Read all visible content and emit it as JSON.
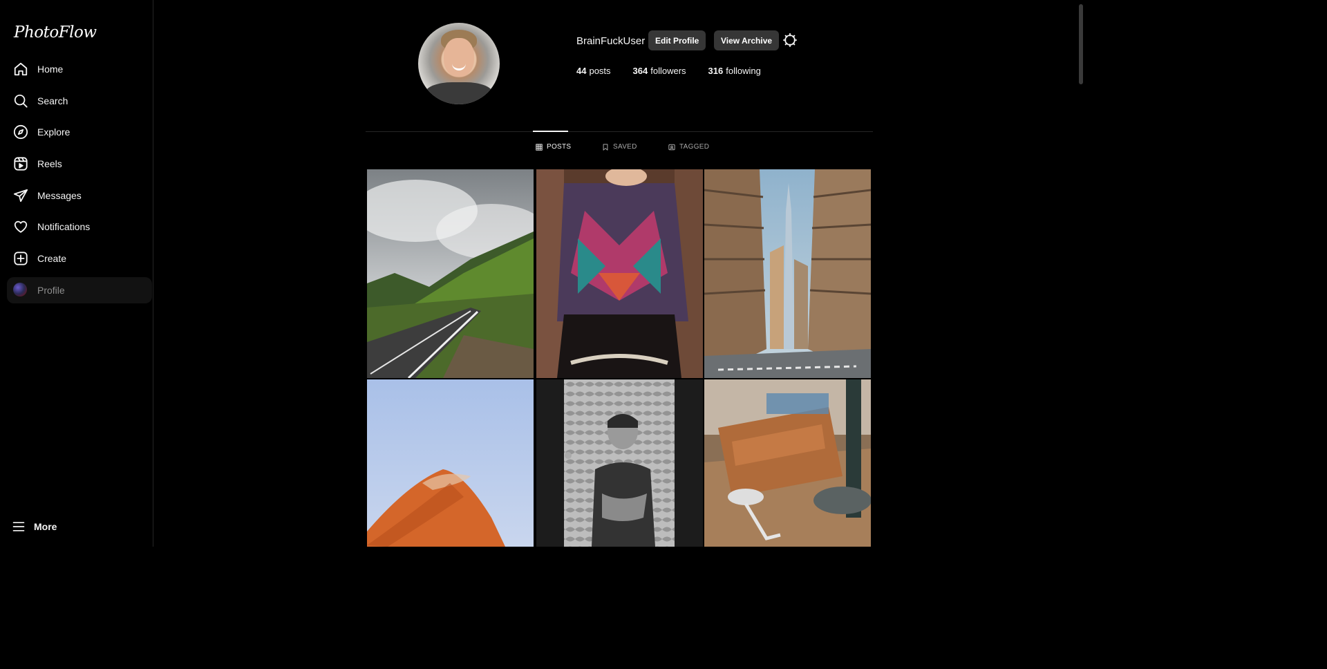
{
  "app": {
    "logo": "PhotoFlow"
  },
  "sidebar": {
    "items": [
      {
        "label": "Home",
        "icon": "home-icon"
      },
      {
        "label": "Search",
        "icon": "search-icon"
      },
      {
        "label": "Explore",
        "icon": "compass-icon"
      },
      {
        "label": "Reels",
        "icon": "reels-icon"
      },
      {
        "label": "Messages",
        "icon": "send-icon"
      },
      {
        "label": "Notifications",
        "icon": "heart-icon"
      },
      {
        "label": "Create",
        "icon": "plus-square-icon"
      },
      {
        "label": "Profile",
        "icon": "avatar",
        "active": true
      }
    ],
    "more_label": "More"
  },
  "profile": {
    "username": "BrainFuckUser",
    "edit_label": "Edit Profile",
    "archive_label": "View Archive",
    "stats": {
      "posts_count": "44",
      "posts_label": "posts",
      "followers_count": "364",
      "followers_label": "followers",
      "following_count": "316",
      "following_label": "following"
    }
  },
  "tabs": [
    {
      "label": "POSTS",
      "icon": "grid-icon",
      "active": true
    },
    {
      "label": "SAVED",
      "icon": "bookmark-icon",
      "active": false
    },
    {
      "label": "TAGGED",
      "icon": "tag-icon",
      "active": false
    }
  ],
  "posts": [
    {
      "subject": "mountain road"
    },
    {
      "subject": "colorful poncho"
    },
    {
      "subject": "city street skyscraper"
    },
    {
      "subject": "sand dune and sky"
    },
    {
      "subject": "boy in doorway"
    },
    {
      "subject": "leather wallet and tools"
    }
  ],
  "colors": {
    "background": "#000000",
    "button": "#363636",
    "text": "#f5f5f5",
    "muted": "#a8a8a8"
  }
}
